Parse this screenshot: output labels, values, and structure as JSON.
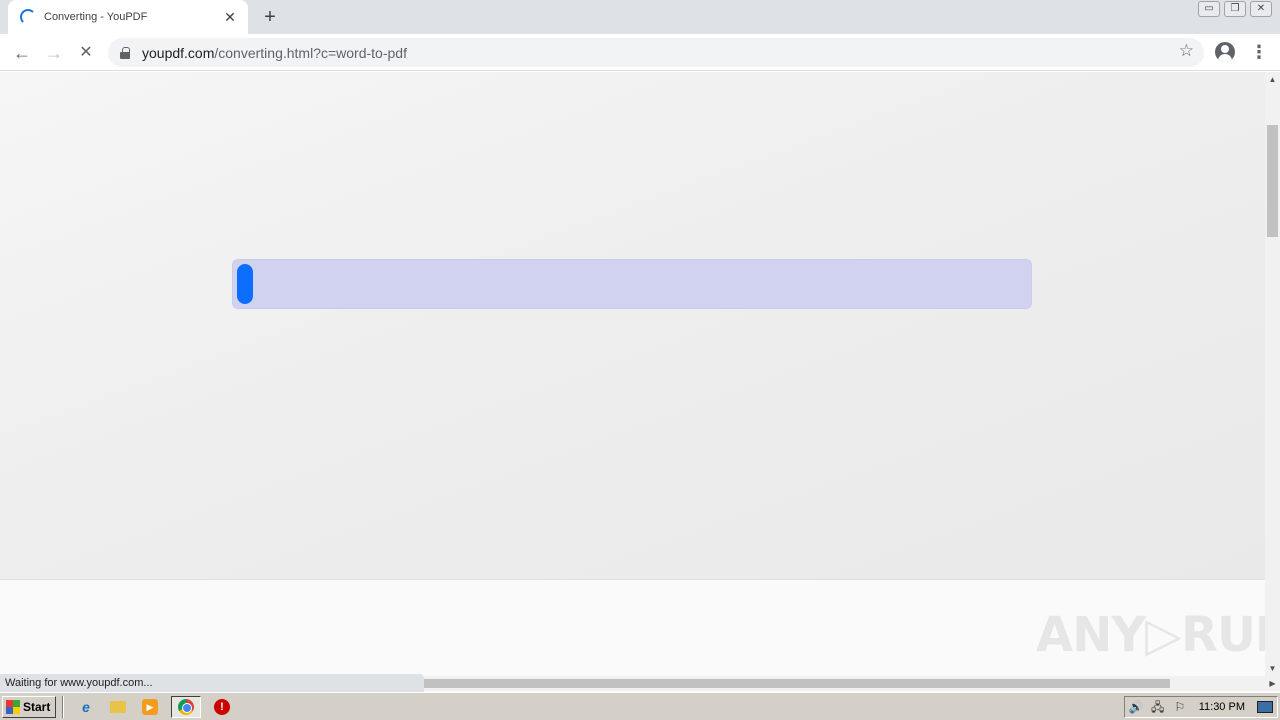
{
  "browser": {
    "tab": {
      "title": "Converting - YouPDF",
      "close": "✕"
    },
    "new_tab": "+",
    "window_buttons": {
      "minimize": "▭",
      "restore": "❐",
      "close": "✕"
    },
    "nav": {
      "back": "←",
      "forward": "→",
      "stop": "✕"
    },
    "omnibox": {
      "host": "youpdf.com",
      "path": "/converting.html?c=word-to-pdf"
    },
    "bookmark": "☆",
    "menu": "⋮",
    "status": "Waiting for www.youpdf.com..."
  },
  "page": {
    "progress_percent": 2,
    "watermark": "ANY▷RUN"
  },
  "scrollbars": {
    "up": "▲",
    "down": "▼",
    "right": "▶"
  },
  "taskbar": {
    "start": "Start",
    "clock": "11:30 PM",
    "tray": {
      "volume": "🔊",
      "network": "🖧",
      "flag": "⚐"
    }
  },
  "colors": {
    "progress_track": "#d0d2f0",
    "progress_fill": "#0d6efd",
    "spinner": "#1a73e8"
  }
}
